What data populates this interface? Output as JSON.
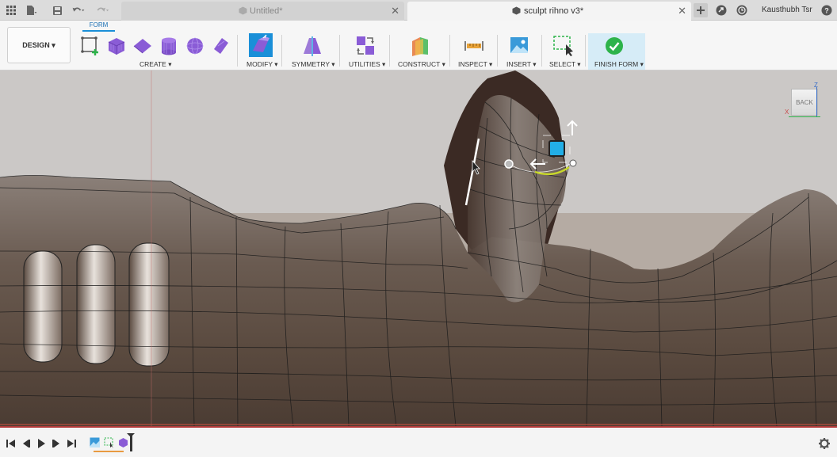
{
  "tabs": [
    {
      "label": "Untitled*",
      "active": false
    },
    {
      "label": "sculpt rihno v3*",
      "active": true
    }
  ],
  "user_name": "Kausthubh Tsr",
  "workspace": {
    "active_tab": "FORM",
    "design_label": "DESIGN ▾"
  },
  "toolbar_groups": {
    "create": "CREATE ▾",
    "modify": "MODIFY ▾",
    "symmetry": "SYMMETRY ▾",
    "utilities": "UTILITIES ▾",
    "construct": "CONSTRUCT ▾",
    "inspect": "INSPECT ▾",
    "insert": "INSERT ▾",
    "select": "SELECT ▾",
    "finish": "FINISH FORM ▾"
  },
  "viewcube": {
    "face": "BACK",
    "axis_z": "Z",
    "axis_x": "X"
  },
  "colors": {
    "accent": "#1a8fd8",
    "finish": "#2db34a",
    "form_purple": "#8a5cd6",
    "timeline_red": "#b23b3b"
  },
  "icons": [
    "apps-grid-icon",
    "file-icon",
    "save-icon",
    "undo-icon",
    "redo-icon",
    "new-tab-icon",
    "jobs-icon",
    "clock-icon",
    "help-icon"
  ]
}
